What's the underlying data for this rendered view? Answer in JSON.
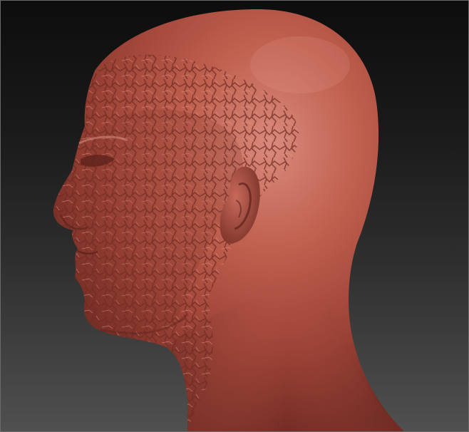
{
  "viewport": {
    "background_top": "#0d0d0d",
    "background_bottom": "#505050",
    "border_color": "#6a6a6a"
  },
  "model": {
    "subject": "sculpted-head-bust",
    "material_color": "#b8584a",
    "shadow_color": "#6e2a22",
    "highlight_color": "#d98a7c"
  }
}
